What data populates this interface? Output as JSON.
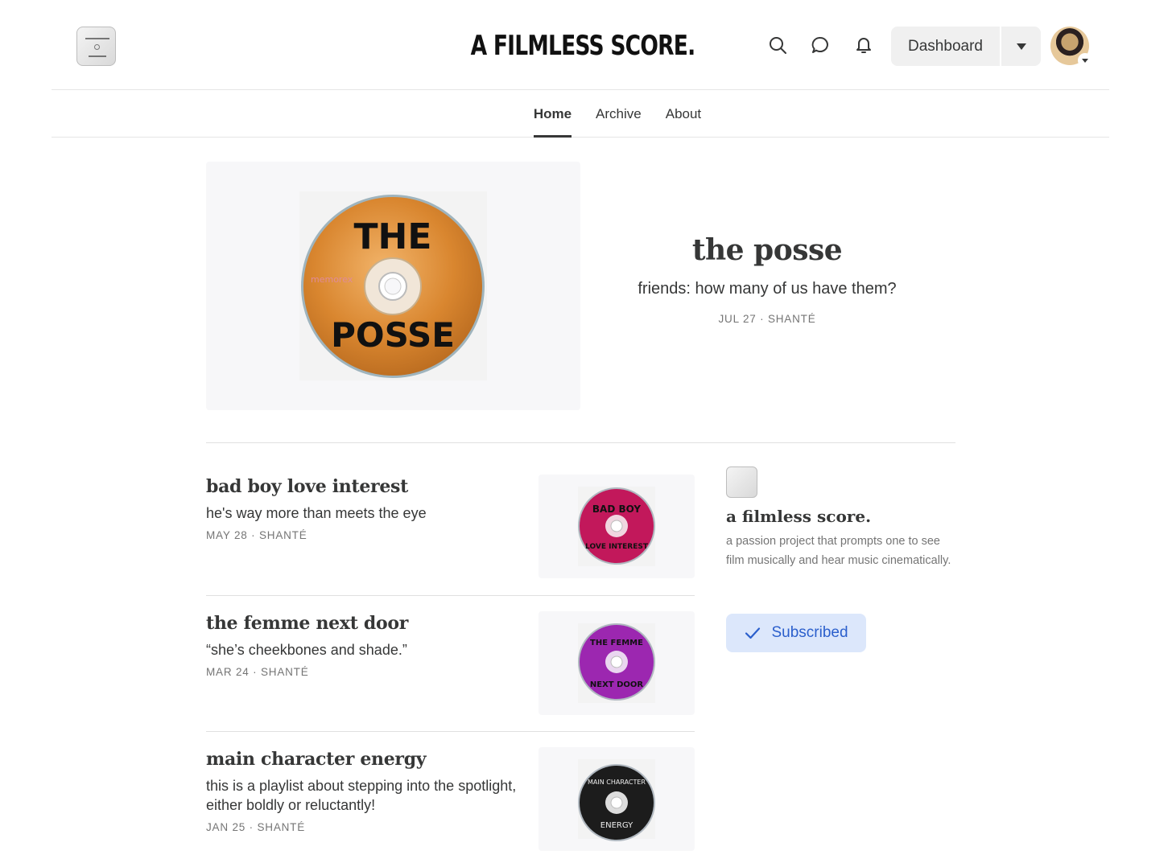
{
  "header": {
    "brand_title": "A FILMLESS SCORE.",
    "dashboard_label": "Dashboard",
    "icons": [
      "search-icon",
      "chat-icon",
      "bell-icon",
      "caret-down-icon"
    ]
  },
  "nav": {
    "items": [
      {
        "label": "Home",
        "active": true
      },
      {
        "label": "Archive",
        "active": false
      },
      {
        "label": "About",
        "active": false
      }
    ]
  },
  "hero": {
    "disc_text_top": "THE",
    "disc_text_bottom": "POSSE",
    "disc_brand": "memorex",
    "title": "the posse",
    "subtitle": "friends: how many of us have them?",
    "meta": "JUL 27 · SHANTÉ",
    "disc_color": "#d9862f"
  },
  "posts": [
    {
      "title": "bad boy love interest",
      "subtitle": "he's way more than meets the eye",
      "meta": "MAY 28 · SHANTÉ",
      "disc_color": "#c2185b",
      "disc_text_top": "BAD BOY",
      "disc_text_bottom": "LOVE INTEREST"
    },
    {
      "title": "the femme next door",
      "subtitle": "“she’s cheekbones and shade.”",
      "meta": "MAR 24 · SHANTÉ",
      "disc_color": "#9c27b0",
      "disc_text_top": "THE FEMME",
      "disc_text_bottom": "NEXT DOOR"
    },
    {
      "title": "main character energy",
      "subtitle": "this is a playlist about stepping into the spotlight, either boldly or reluctantly!",
      "meta": "JAN 25 · SHANTÉ",
      "disc_color": "#1c1c1c",
      "disc_text_top": "MAIN CHARACTER",
      "disc_text_bottom": "ENERGY"
    }
  ],
  "sidebar": {
    "title": "a filmless score.",
    "description": "a passion project that prompts one to see film musically and hear music cinematically.",
    "subscribe_label": "Subscribed"
  },
  "colors": {
    "accent_blue": "#2b5fcc",
    "subscribed_bg": "#dce7fb",
    "text": "#363737",
    "meta": "#757575"
  }
}
